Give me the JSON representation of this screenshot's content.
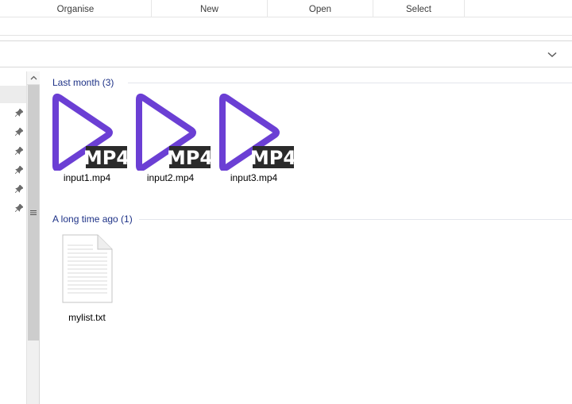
{
  "ribbon": {
    "groups": [
      "Organise",
      "New",
      "Open",
      "Select"
    ]
  },
  "groups": [
    {
      "title": "Last month (3)",
      "items": [
        {
          "name": "input1.mp4",
          "badge": "MP4"
        },
        {
          "name": "input2.mp4",
          "badge": "MP4"
        },
        {
          "name": "input3.mp4",
          "badge": "MP4"
        }
      ]
    },
    {
      "title": "A long time ago (1)",
      "items": [
        {
          "name": "mylist.txt"
        }
      ]
    }
  ],
  "colors": {
    "video_icon": "#6b3fd4",
    "badge_bg": "#2b2b2b",
    "group_header": "#1e3287"
  },
  "icons": {
    "video_file": "mp4-video-file-icon",
    "text_file": "text-document-icon",
    "pin": "pin-icon",
    "dropdown": "chevron-down-icon",
    "scroll_up": "scroll-up-arrow-icon"
  }
}
